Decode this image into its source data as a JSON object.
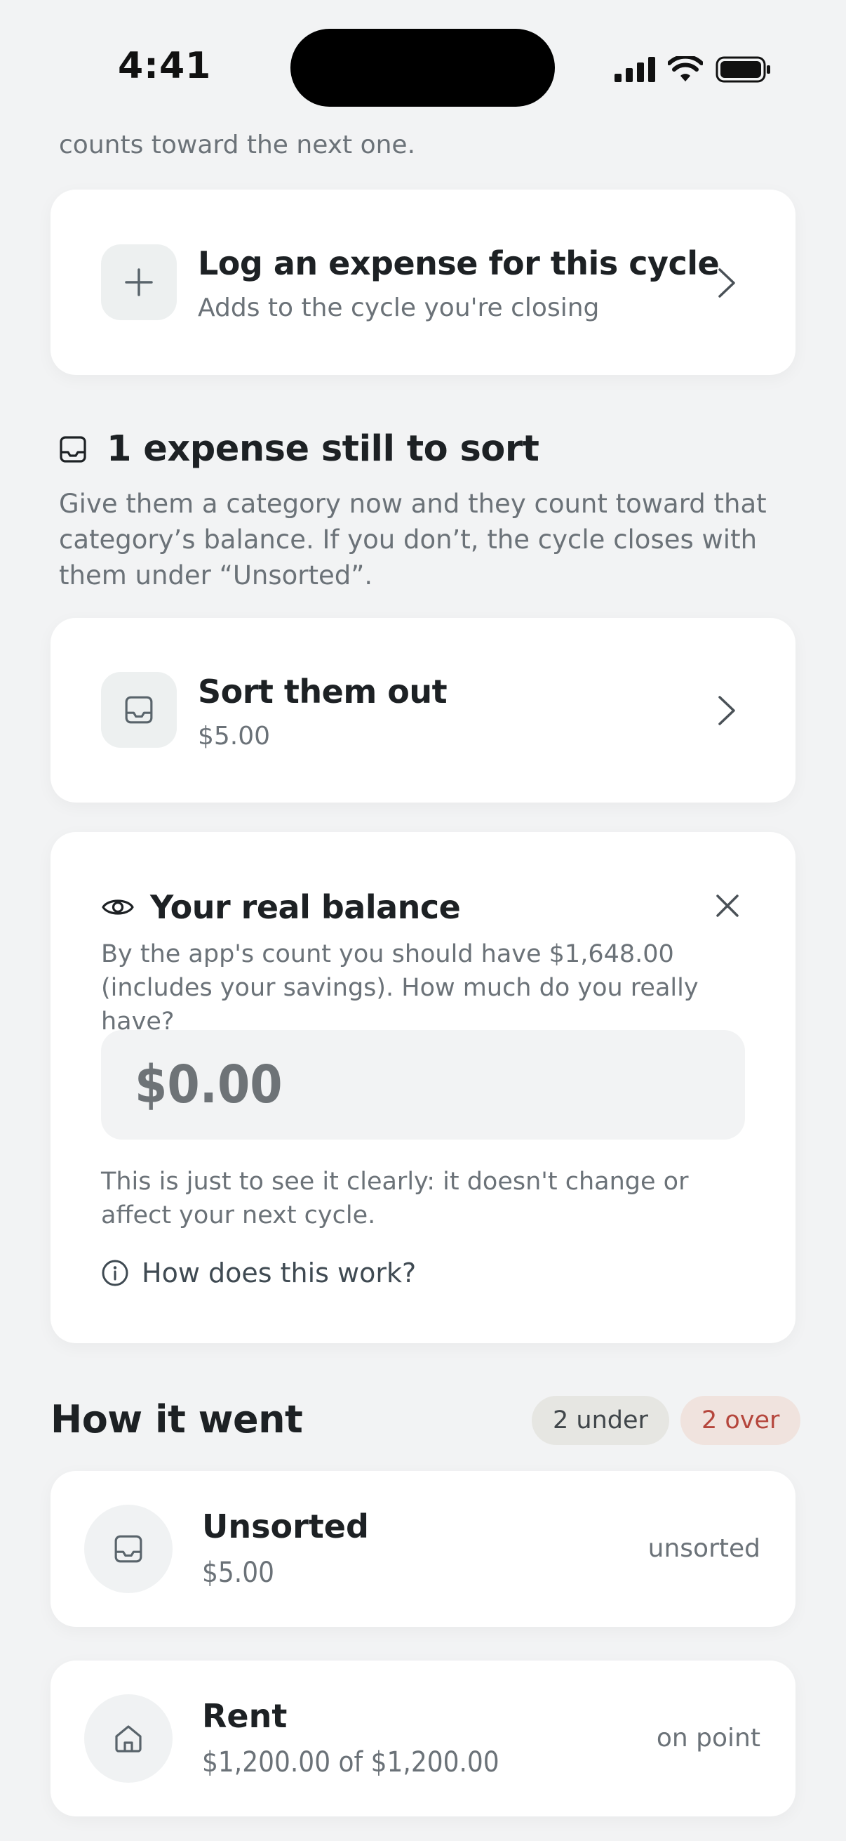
{
  "status_bar": {
    "time": "4:41"
  },
  "intro": {
    "tail_text": "counts toward the next one."
  },
  "log_expense": {
    "title": "Log an expense for this cycle",
    "subtitle": "Adds to the cycle you're closing",
    "icon": "plus-icon"
  },
  "unsorted_section": {
    "heading": "1 expense still to sort",
    "description": "Give them a category now and they count toward that category’s balance. If you don’t, the cycle closes with them under “Unsorted”.",
    "icon": "inbox-icon"
  },
  "sort_card": {
    "title": "Sort them out",
    "amount": "$5.00",
    "icon": "inbox-icon"
  },
  "real_balance": {
    "title": "Your real balance",
    "description": "By the app's count you should have $1,648.00 (includes your savings). How much do you really have?",
    "input_placeholder": "$0.00",
    "input_value": "",
    "note": "This is just to see it clearly: it doesn't change or affect your next cycle.",
    "help_link": "How does this work?",
    "icon": "eye-icon"
  },
  "how_it_went": {
    "title": "How it went",
    "badges": {
      "under": "2 under",
      "over": "2 over"
    },
    "colors": {
      "over": "#b5463c",
      "under_bg": "#e6e6e2",
      "over_bg": "#f0e3de"
    },
    "categories": [
      {
        "name": "Unsorted",
        "amount": "$5.00",
        "status": "unsorted",
        "icon": "inbox-icon"
      },
      {
        "name": "Rent",
        "amount": "$1,200.00 of $1,200.00",
        "status": "on point",
        "icon": "home-icon"
      }
    ]
  }
}
